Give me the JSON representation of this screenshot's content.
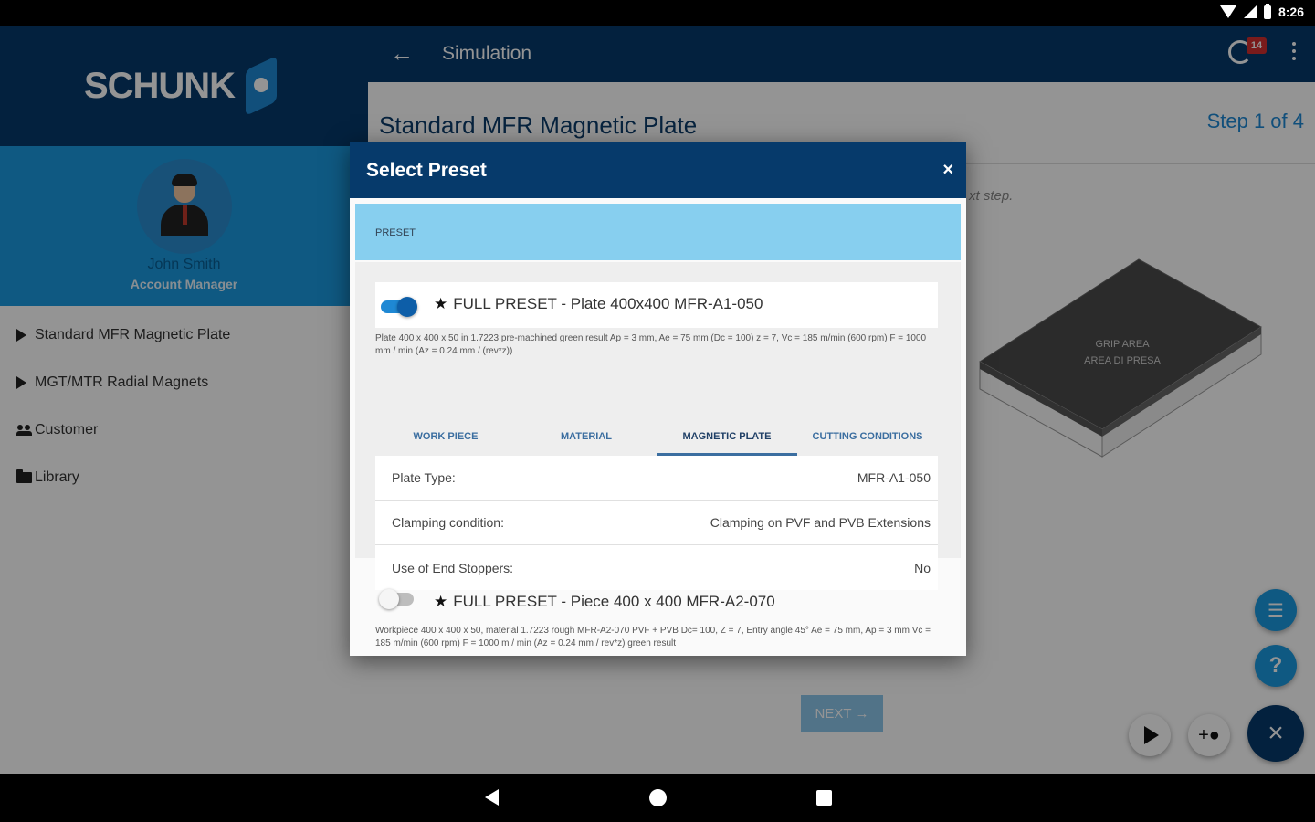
{
  "status": {
    "time": "8:26"
  },
  "sidebar": {
    "logo": "SCHUNK",
    "user_name": "John Smith",
    "user_role": "Account Manager",
    "items": [
      {
        "label": "Standard MFR Magnetic Plate",
        "icon": "triangle-right-icon"
      },
      {
        "label": "MGT/MTR Radial Magnets",
        "icon": "triangle-right-icon"
      },
      {
        "label": "Customer",
        "icon": "people-icon"
      },
      {
        "label": "Library",
        "icon": "folder-icon"
      }
    ]
  },
  "toolbar": {
    "back": "←",
    "title": "Simulation",
    "sync_badge": "14"
  },
  "page": {
    "title": "Standard MFR Magnetic Plate",
    "step": "Step 1 of 4",
    "hint": "xt step.",
    "next_label": "NEXT →"
  },
  "plate_image_text": [
    "GRIP AREA",
    "AREA DI PRESA"
  ],
  "dialog": {
    "title": "Select Preset",
    "close": "×",
    "section": "PRESET",
    "presets": [
      {
        "title": "FULL PRESET - Plate 400x400 MFR-A1-050",
        "enabled": true,
        "description": "Plate 400 x 400 x 50 in 1.7223 pre-machined  green result  Ap = 3 mm, Ae = 75 mm (Dc = 100) z = 7, Vc = 185 m/min (600 rpm) F = 1000 mm / min (Az = 0.24 mm / (rev*z))"
      },
      {
        "title": "FULL PRESET - Piece 400 x 400 MFR-A2-070",
        "enabled": false,
        "description": "Workpiece 400 x 400 x 50, material 1.7223 rough MFR-A2-070  PVF + PVB  Dc= 100, Z = 7, Entry angle 45° Ae = 75 mm, Ap = 3 mm Vc = 185 m/min (600 rpm) F = 1000 m / min (Az = 0.24 mm / rev*z)  green result"
      }
    ],
    "tabs": [
      "WORK PIECE",
      "MATERIAL",
      "MAGNETIC PLATE",
      "CUTTING CONDITIONS"
    ],
    "active_tab": "MAGNETIC PLATE",
    "properties": [
      {
        "label": "Plate Type:",
        "value": "MFR-A1-050"
      },
      {
        "label": "Clamping condition:",
        "value": "Clamping on PVF and PVB Extensions"
      },
      {
        "label": "Use of End Stoppers:",
        "value": "No"
      }
    ]
  },
  "fabs": {
    "help": "?",
    "close": "×"
  },
  "colors": {
    "primary": "#063a6b",
    "accent": "#1a9ae0",
    "section": "#87cfef"
  }
}
